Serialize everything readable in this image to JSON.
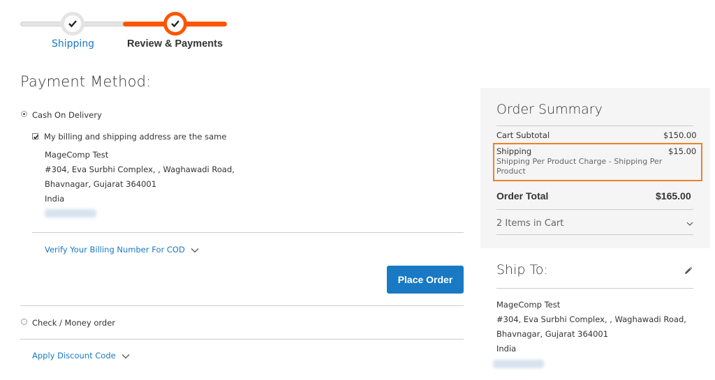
{
  "progress": {
    "steps": [
      {
        "label": "Shipping",
        "state": "done"
      },
      {
        "label": "Review & Payments",
        "state": "active"
      }
    ]
  },
  "payment": {
    "title": "Payment Method:",
    "cod_label": "Cash On Delivery",
    "same_address_label": "My billing and shipping address are the same",
    "address": {
      "name": "MageComp Test",
      "line1": "#304, Eva Surbhi Complex, , Waghawadi Road,",
      "line2": "Bhavnagar, Gujarat 364001",
      "country": "India"
    },
    "verify_link": "Verify Your Billing Number For COD",
    "place_order": "Place Order",
    "check_money_label": "Check / Money order",
    "discount_link": "Apply Discount Code"
  },
  "summary": {
    "title": "Order Summary",
    "subtotal_label": "Cart Subtotal",
    "subtotal_value": "$150.00",
    "shipping_label": "Shipping",
    "shipping_value": "$15.00",
    "shipping_method": "Shipping Per Product Charge - Shipping Per Product",
    "total_label": "Order Total",
    "total_value": "$165.00",
    "items_in_cart": "2 Items in Cart"
  },
  "ship_to": {
    "title": "Ship To:",
    "name": "MageComp Test",
    "line1": "#304, Eva Surbhi Complex, , Waghawadi Road,",
    "line2": "Bhavnagar, Gujarat 364001",
    "country": "India"
  },
  "colors": {
    "accent": "#ff5501",
    "link": "#1979c3",
    "button": "#1979c3",
    "highlight": "#e8832a"
  }
}
